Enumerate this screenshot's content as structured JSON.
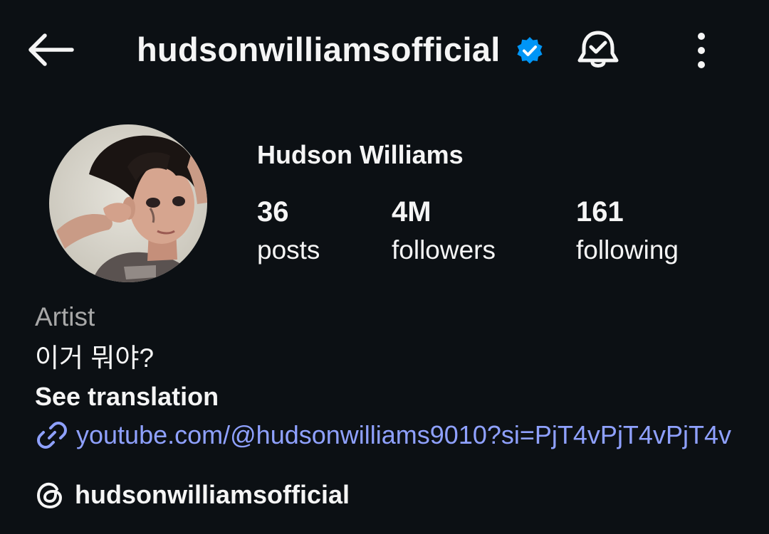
{
  "header": {
    "handle": "hudsonwilliamsofficial",
    "verified": true,
    "verified_color": "#0095f6",
    "icons": [
      "back-arrow-icon",
      "verified-badge-icon",
      "bell-check-icon",
      "more-vertical-icon"
    ]
  },
  "profile": {
    "display_name": "Hudson Williams",
    "stats": {
      "posts_count": "36",
      "posts_label": "posts",
      "followers_count": "4M",
      "followers_label": "followers",
      "following_count": "161",
      "following_label": "following"
    },
    "category": "Artist",
    "bio": "이거 뭐야?",
    "see_translation": "See translation",
    "link": {
      "text": "youtube.com/@hudsonwilliams9010?si=PjT4vPjT4vPjT4v",
      "icon": "link-icon",
      "color": "#8fa1ff"
    },
    "threads": {
      "handle": "hudsonwilliamsofficial",
      "icon": "threads-icon"
    }
  },
  "colors": {
    "background": "#0c1014",
    "text": "#f5f5f5",
    "muted": "#a8a8a8"
  }
}
